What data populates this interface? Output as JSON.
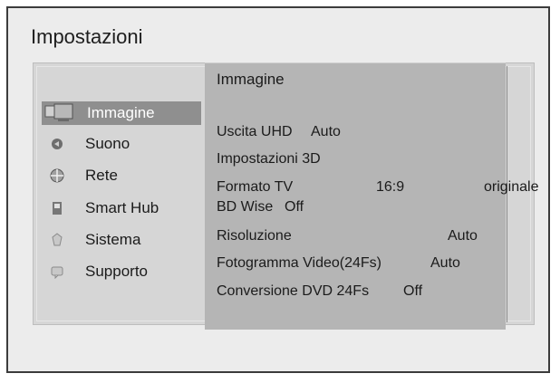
{
  "window": {
    "title": "Impostazioni"
  },
  "sidebar": {
    "items": [
      {
        "label": "Immagine",
        "icon": "picture-icon",
        "selected": true
      },
      {
        "label": "Suono",
        "icon": "sound-icon",
        "selected": false
      },
      {
        "label": "Rete",
        "icon": "network-icon",
        "selected": false
      },
      {
        "label": "Smart Hub",
        "icon": "smart-hub-icon",
        "selected": false
      },
      {
        "label": "Sistema",
        "icon": "system-icon",
        "selected": false
      },
      {
        "label": "Supporto",
        "icon": "support-icon",
        "selected": false
      }
    ]
  },
  "content": {
    "title": "Immagine",
    "rows": [
      {
        "label": "Uscita UHD",
        "value": "Auto",
        "extra": ""
      },
      {
        "label": "Impostazioni 3D",
        "value": "",
        "extra": ""
      },
      {
        "label": "Formato TV",
        "value": "16:9",
        "extra": "originale"
      },
      {
        "label": "BD Wise",
        "value": "Off",
        "extra": ""
      },
      {
        "label": "Risoluzione",
        "value": "Auto",
        "extra": ""
      },
      {
        "label": "Fotogramma Video(24Fs)",
        "value": "Auto",
        "extra": ""
      },
      {
        "label": "Conversione DVD 24Fs",
        "value": "Off",
        "extra": ""
      }
    ]
  },
  "colors": {
    "selected_bg": "#8f8f8f",
    "content_bg": "#b5b5b5",
    "panel_bg": "#d6d6d6",
    "frame_bg": "#ececec"
  }
}
